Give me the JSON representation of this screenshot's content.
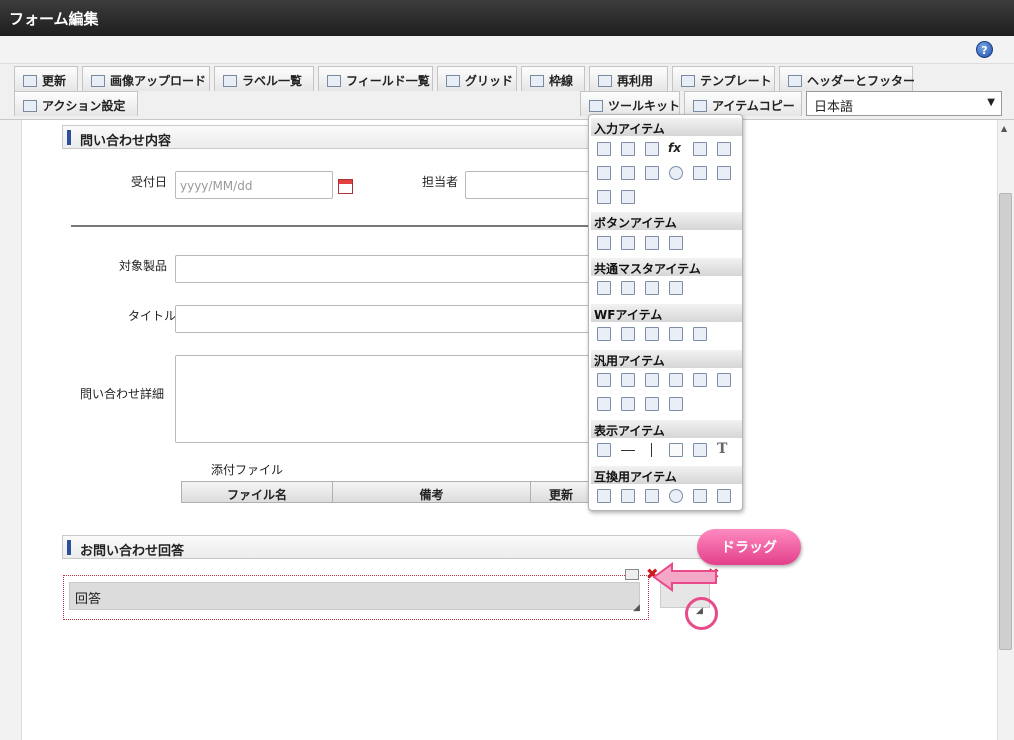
{
  "title": "フォーム編集",
  "toolbar": {
    "row1": [
      "更新",
      "画像アップロード",
      "ラベル一覧",
      "フィールド一覧",
      "グリッド",
      "枠線",
      "再利用",
      "テンプレート",
      "ヘッダーとフッター"
    ],
    "action": "アクション設定",
    "toolkit": "ツールキット",
    "itemcopy": "アイテムコピー",
    "language": "日本語"
  },
  "form": {
    "section1": "問い合わせ内容",
    "received_label": "受付日",
    "received_placeholder": "yyyy/MM/dd",
    "person_label": "担当者",
    "product_label": "対象製品",
    "title_label": "タイトル",
    "detail_label": "問い合わせ詳細",
    "attachment_label": "添付ファイル",
    "columns": [
      "ファイル名",
      "備考",
      "更新"
    ],
    "section2": "お問い合わせ回答",
    "answer_label": "回答"
  },
  "palette": {
    "sections": [
      "入力アイテム",
      "ボタンアイテム",
      "共通マスタアイテム",
      "WFアイテム",
      "汎用アイテム",
      "表示アイテム",
      "互換用アイテム"
    ],
    "fx": "fx"
  },
  "callout": "ドラッグ",
  "colors": {
    "accent": "#2d4f9a",
    "callout": "#e94b8a",
    "delete": "#cc1d1d"
  }
}
